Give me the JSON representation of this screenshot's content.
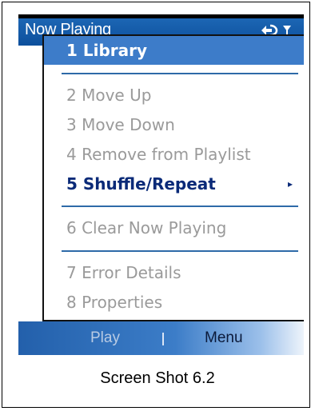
{
  "header": {
    "title": "Now Playing"
  },
  "status_icons": {
    "connectivity": "sync-icon",
    "signal": "signal-icon"
  },
  "menu": {
    "items": [
      {
        "label": "1 Library",
        "state": "selected"
      },
      {
        "label": "2 Move Up",
        "state": "disabled"
      },
      {
        "label": "3 Move Down",
        "state": "disabled"
      },
      {
        "label": "4 Remove from Playlist",
        "state": "disabled"
      },
      {
        "label": "5 Shuffle/Repeat",
        "state": "active",
        "submenu": true
      },
      {
        "label": "6 Clear Now Playing",
        "state": "disabled"
      },
      {
        "label": "7 Error Details",
        "state": "disabled"
      },
      {
        "label": "8 Properties",
        "state": "disabled"
      }
    ],
    "submenu_arrow": "▸"
  },
  "softkeys": {
    "left": "Play",
    "right": "Menu"
  },
  "caption": "Screen Shot 6.2",
  "colors": {
    "titlebar": "#0d4f9c",
    "selection": "#3d7cc9",
    "active_text": "#0a2a78",
    "disabled_text": "#9a9a9a"
  }
}
